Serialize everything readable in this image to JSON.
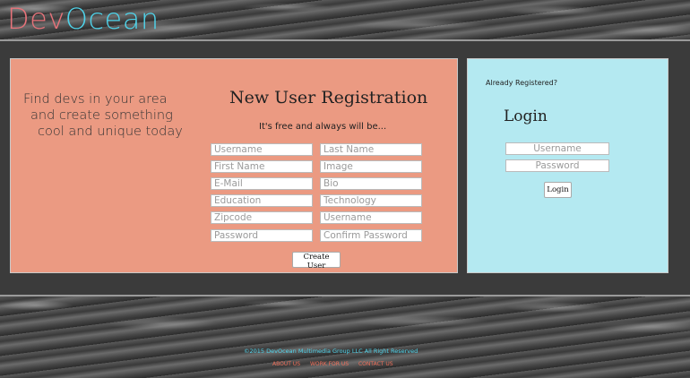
{
  "header": {
    "logo_part1": "Dev",
    "logo_part2": "Ocean"
  },
  "tagline": {
    "line1": "Find devs in your area",
    "line2": "and create something",
    "line3": "cool and unique today"
  },
  "registration": {
    "title": "New User Registration",
    "subtitle": "It's free and always will be...",
    "fields": {
      "username": "Username",
      "last_name": "Last Name",
      "first_name": "First Name",
      "image": "Image",
      "email": "E-Mail",
      "bio": "Bio",
      "education": "Education",
      "technology": "Technology",
      "zipcode": "Zipcode",
      "username2": "Username",
      "password": "Password",
      "confirm_password": "Confirm Password"
    },
    "submit_label": "Create User"
  },
  "login": {
    "already_registered": "Already Registered?",
    "title": "Login",
    "username_placeholder": "Username",
    "password_placeholder": "Password",
    "button_label": "Login"
  },
  "footer": {
    "copyright": "©2015 DevOcean Multimedia Group LLC All Right Reserved",
    "links": [
      "ABOUT US",
      "WORK FOR US",
      "CONTACT US"
    ]
  },
  "colors": {
    "registration_panel": "#eb9a82",
    "login_panel": "#b4e9f1",
    "logo_dev": "#e8737a",
    "logo_ocean": "#4fd3ea",
    "footer_link": "#ef6f5a"
  }
}
